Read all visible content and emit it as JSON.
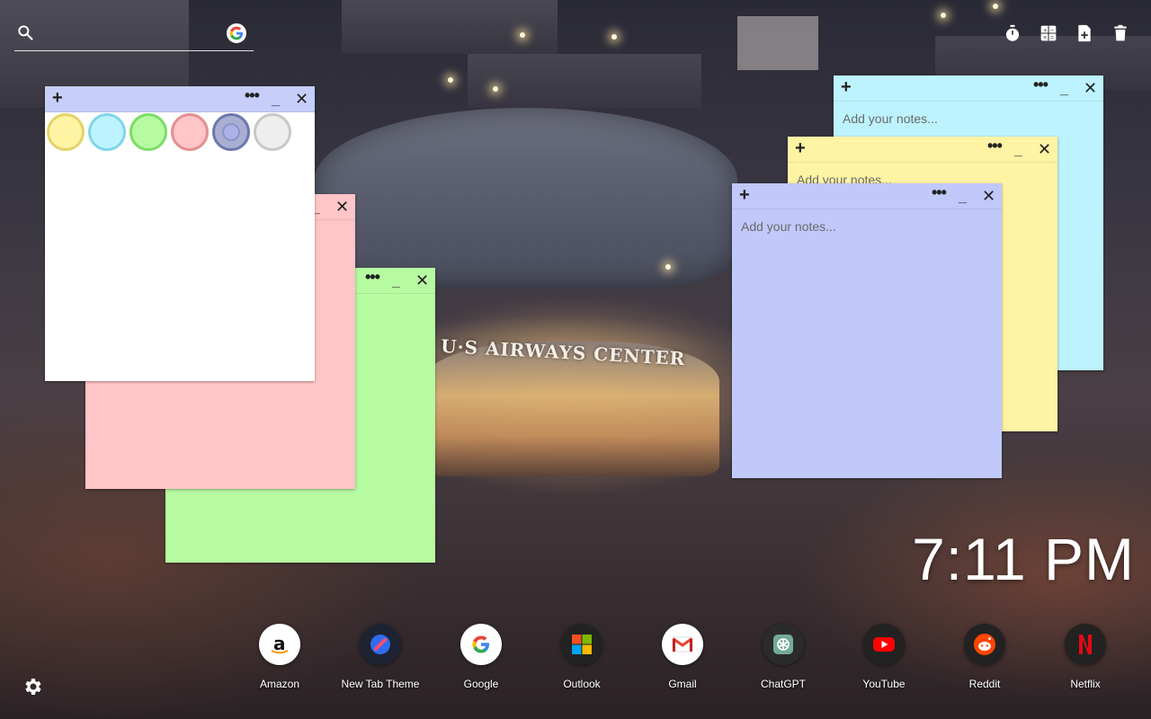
{
  "search": {
    "placeholder": ""
  },
  "top_tools": [
    "timer-icon",
    "calculator-icon",
    "new-note-icon",
    "trash-icon"
  ],
  "notes": [
    {
      "id": "white",
      "color": "#ffffff",
      "placeholder": ""
    },
    {
      "id": "pink",
      "color": "#ffc5c7",
      "placeholder": ""
    },
    {
      "id": "green",
      "color": "#b6fba1",
      "placeholder": ""
    },
    {
      "id": "cyan",
      "color": "#bdf3fe",
      "placeholder": "Add your notes..."
    },
    {
      "id": "yellow",
      "color": "#fff3a4",
      "placeholder": "Add your notes..."
    },
    {
      "id": "blue",
      "color": "#c0c9fa",
      "placeholder": "Add your notes..."
    }
  ],
  "note_controls": {
    "add": "+",
    "menu": "•••",
    "minimize": "_",
    "close": "✕"
  },
  "swatches": [
    {
      "name": "yellow",
      "color": "#fff3a4",
      "border": "#e3d36a"
    },
    {
      "name": "cyan",
      "color": "#bdf3fe",
      "border": "#7fd6ea"
    },
    {
      "name": "green",
      "color": "#b6fba1",
      "border": "#7ddc66"
    },
    {
      "name": "pink",
      "color": "#ffc5c7",
      "border": "#e48f93"
    },
    {
      "name": "blue",
      "color": "#8d95c4",
      "border": "#6f78ad",
      "active": true
    },
    {
      "name": "white",
      "color": "#eeeeee",
      "border": "#c8c8c8"
    }
  ],
  "clock": {
    "time": "7:11 PM"
  },
  "background": {
    "sign": "U·S AIRWAYS CENTER"
  },
  "dock": [
    {
      "label": "Amazon",
      "icon": "amazon-icon"
    },
    {
      "label": "New Tab Theme",
      "icon": "new-tab-theme-icon"
    },
    {
      "label": "Google",
      "icon": "google-icon"
    },
    {
      "label": "Outlook",
      "icon": "outlook-icon"
    },
    {
      "label": "Gmail",
      "icon": "gmail-icon"
    },
    {
      "label": "ChatGPT",
      "icon": "chatgpt-icon"
    },
    {
      "label": "YouTube",
      "icon": "youtube-icon"
    },
    {
      "label": "Reddit",
      "icon": "reddit-icon"
    },
    {
      "label": "Netflix",
      "icon": "netflix-icon"
    }
  ]
}
